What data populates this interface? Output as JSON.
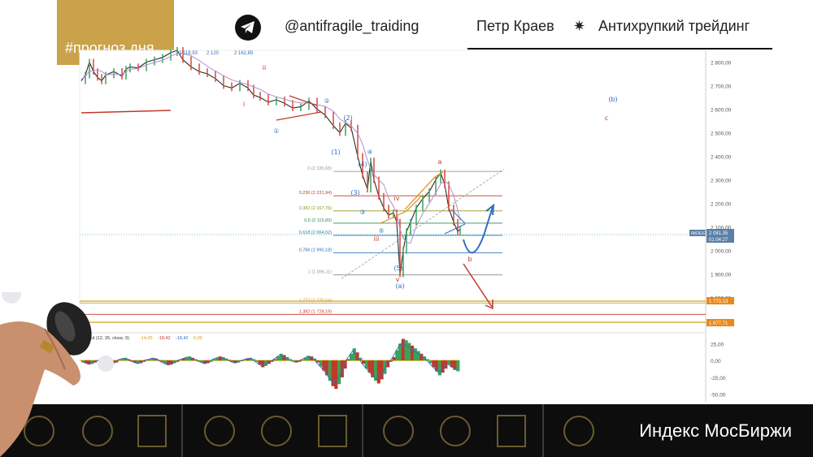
{
  "header": {
    "tag": "#прогноз дня",
    "handle": "@antifragile_traiding",
    "author": "Петр Краев",
    "separator_icon": "star-burst-icon",
    "project": "Антихрупкий трейдинг"
  },
  "footer": {
    "label": "Индекс МосБиржи"
  },
  "colors": {
    "gold": "#c9a24a",
    "bear": "#d44a3a",
    "bull": "#3aa35a",
    "wave": "#2f6fc0",
    "wave_red": "#c0392b"
  },
  "chart_data": {
    "type": "candlestick",
    "price_axis": {
      "ticks": [
        "2 800,00",
        "2 700,00",
        "2 600,00",
        "2 500,00",
        "2 400,00",
        "2 300,00",
        "2 200,00",
        "2 100,00",
        "2 000,00",
        "1 900,00",
        "1 800,00",
        "1 700,00"
      ],
      "ylim": [
        1650,
        2850
      ]
    },
    "top_labels": [
      "2 118,93",
      "2 120",
      "2 162,85"
    ],
    "price_series": [
      [
        0,
        2720
      ],
      [
        5,
        2745
      ],
      [
        10,
        2800
      ],
      [
        15,
        2760
      ],
      [
        20,
        2735
      ],
      [
        25,
        2720
      ],
      [
        30,
        2745
      ],
      [
        40,
        2760
      ],
      [
        50,
        2740
      ],
      [
        55,
        2770
      ],
      [
        60,
        2780
      ],
      [
        70,
        2775
      ],
      [
        80,
        2800
      ],
      [
        90,
        2810
      ],
      [
        100,
        2820
      ],
      [
        110,
        2840
      ],
      [
        118,
        2850
      ],
      [
        125,
        2810
      ],
      [
        135,
        2780
      ],
      [
        145,
        2760
      ],
      [
        155,
        2750
      ],
      [
        165,
        2730
      ],
      [
        175,
        2700
      ],
      [
        185,
        2690
      ],
      [
        195,
        2710
      ],
      [
        205,
        2690
      ],
      [
        212,
        2660
      ],
      [
        220,
        2650
      ],
      [
        230,
        2630
      ],
      [
        240,
        2640
      ],
      [
        250,
        2625
      ],
      [
        260,
        2605
      ],
      [
        270,
        2610
      ],
      [
        280,
        2635
      ],
      [
        290,
        2600
      ],
      [
        300,
        2575
      ],
      [
        310,
        2530
      ],
      [
        318,
        2500
      ],
      [
        325,
        2540
      ],
      [
        332,
        2520
      ],
      [
        340,
        2400
      ],
      [
        346,
        2320
      ],
      [
        352,
        2260
      ],
      [
        356,
        2380
      ],
      [
        360,
        2300
      ],
      [
        366,
        2230
      ],
      [
        372,
        2180
      ],
      [
        378,
        2150
      ],
      [
        384,
        2160
      ],
      [
        388,
        2120
      ],
      [
        392,
        1900
      ],
      [
        396,
        2000
      ],
      [
        400,
        2080
      ],
      [
        405,
        2120
      ],
      [
        412,
        2180
      ],
      [
        420,
        2220
      ],
      [
        428,
        2250
      ],
      [
        436,
        2300
      ],
      [
        442,
        2330
      ],
      [
        447,
        2280
      ],
      [
        452,
        2180
      ],
      [
        458,
        2120
      ],
      [
        463,
        2080
      ],
      [
        466,
        2090
      ]
    ],
    "fibonacci": [
      {
        "label": "0 (2 335,68)",
        "value": 2335.68,
        "color": "#999999"
      },
      {
        "label": "0,236 (2 231,94)",
        "value": 2231.94,
        "color": "#c0392b"
      },
      {
        "label": "0,382 (2 167,76)",
        "value": 2167.76,
        "color": "#8a9a1a"
      },
      {
        "label": "0,5 (2 115,89)",
        "value": 2115.89,
        "color": "#2e8b57"
      },
      {
        "label": "0,618 (2 064,02)",
        "value": 2064.02,
        "color": "#1a7fa0"
      },
      {
        "label": "0,786 (1 990,18)",
        "value": 1990.18,
        "color": "#2f6fc0"
      },
      {
        "label": "1 (1 896,11)",
        "value": 1896.11,
        "color": "#999999"
      },
      {
        "label": "1,272 (1 776,54)",
        "value": 1776.54,
        "color": "#c9a24a"
      },
      {
        "label": "1,382 (1 728,19)",
        "value": 1728.19,
        "color": "#c0392b"
      }
    ],
    "price_badges": [
      {
        "label": "IMOEX2",
        "value": "2 081,35",
        "time": "01:04:27",
        "color": "#5b7fa6"
      },
      {
        "label": "1 773,13",
        "color": "#e8891a"
      },
      {
        "label": "1 677,71",
        "color": "#e8891a"
      }
    ],
    "horizontal_levels": [
      1773.13,
      1677.71
    ],
    "wave_labels": [
      {
        "text": "ii",
        "color": "#c0392b"
      },
      {
        "text": "i",
        "color": "#c0392b"
      },
      {
        "text": "①",
        "color": "#2f6fc0"
      },
      {
        "text": "②",
        "color": "#2f6fc0"
      },
      {
        "text": "(2)",
        "color": "#2f6fc0"
      },
      {
        "text": "(1)",
        "color": "#2f6fc0"
      },
      {
        "text": "④",
        "color": "#2f6fc0"
      },
      {
        "text": "(4)",
        "color": "#2f6fc0"
      },
      {
        "text": "(3)",
        "color": "#2f6fc0"
      },
      {
        "text": "③",
        "color": "#2f6fc0"
      },
      {
        "text": "⑤",
        "color": "#2f6fc0"
      },
      {
        "text": "iv",
        "color": "#c0392b"
      },
      {
        "text": "iii",
        "color": "#c0392b"
      },
      {
        "text": "(5)",
        "color": "#2f6fc0"
      },
      {
        "text": "v",
        "color": "#c0392b"
      },
      {
        "text": "(a)",
        "color": "#2f6fc0"
      },
      {
        "text": "a",
        "color": "#c0392b"
      },
      {
        "text": "b",
        "color": "#c0392b"
      },
      {
        "text": "(b)",
        "color": "#2f6fc0"
      },
      {
        "text": "c",
        "color": "#c0392b"
      }
    ],
    "macd": {
      "label": "macd (12, 26, close, 9)",
      "values": [
        "-14,00",
        "-18,42",
        "-18,42",
        "0,00"
      ],
      "value_colors": [
        "#d4a017",
        "#c0392b",
        "#2f6fc0",
        "#d4a017"
      ],
      "axis_ticks": [
        "25,00",
        "0,00",
        "-25,00",
        "-50,00"
      ],
      "ylim": [
        -60,
        35
      ],
      "histogram": [
        -2,
        -4,
        -6,
        -5,
        -3,
        -1,
        2,
        3,
        1,
        -2,
        -4,
        -3,
        1,
        3,
        4,
        2,
        -1,
        -3,
        -5,
        -4,
        -2,
        1,
        2,
        4,
        3,
        1,
        -2,
        -5,
        -7,
        -6,
        -4,
        -2,
        1,
        3,
        5,
        6,
        4,
        2,
        -1,
        -3,
        -5,
        -4,
        -2,
        2,
        4,
        6,
        5,
        3,
        1,
        -2,
        -4,
        -3,
        -1,
        1,
        3,
        4,
        2,
        -2,
        -6,
        -10,
        -8,
        -5,
        -2,
        2,
        6,
        10,
        8,
        5,
        2,
        -1,
        -3,
        -2,
        1,
        4,
        7,
        6,
        3,
        -3,
        -9,
        -15,
        -22,
        -30,
        -38,
        -42,
        -35,
        -25,
        -12,
        2,
        10,
        18,
        12,
        4,
        -5,
        -12,
        -18,
        -25,
        -30,
        -34,
        -28,
        -20,
        -10,
        -2,
        5,
        15,
        25,
        32,
        30,
        26,
        22,
        18,
        14,
        10,
        6,
        2,
        -4,
        -10,
        -16,
        -22,
        -18,
        -12,
        -6,
        -10,
        -14,
        -16
      ]
    }
  }
}
